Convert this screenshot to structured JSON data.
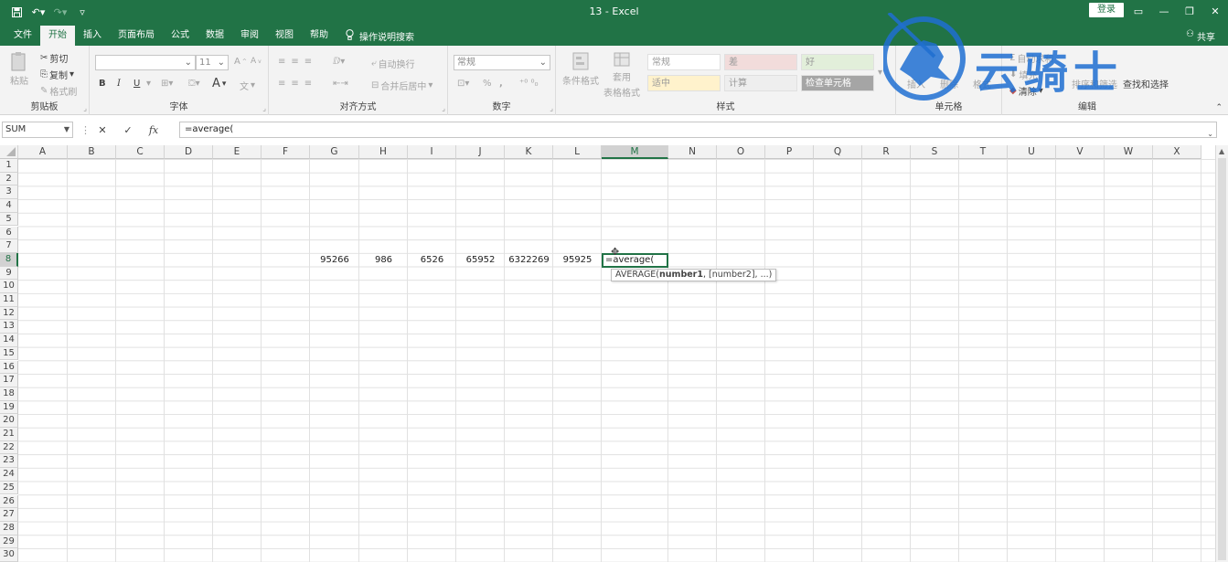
{
  "titlebar": {
    "title": "13  -  Excel",
    "login": "登录",
    "qat_icons": [
      "save-icon",
      "undo-icon",
      "redo-icon",
      "customize-icon"
    ]
  },
  "menu": {
    "tabs": [
      "文件",
      "开始",
      "插入",
      "页面布局",
      "公式",
      "数据",
      "审阅",
      "视图",
      "帮助"
    ],
    "active_tab": "开始",
    "tell_me": "操作说明搜索",
    "share": "共享"
  },
  "ribbon": {
    "clipboard": {
      "label": "剪贴板",
      "paste": "粘贴",
      "cut": "剪切",
      "copy": "复制",
      "format_painter": "格式刷"
    },
    "font": {
      "label": "字体",
      "font_name": "",
      "font_size": "11",
      "bold": "B",
      "italic": "I",
      "underline": "U",
      "grow": "A",
      "color_a": "A",
      "phonetic": "文"
    },
    "alignment": {
      "label": "对齐方式",
      "wrap": "自动换行",
      "merge": "合并后居中"
    },
    "number": {
      "label": "数字",
      "format": "常规",
      "percent": "%",
      "comma": ","
    },
    "styles": {
      "label": "样式",
      "conditional": "条件格式",
      "table": "套用",
      "table2": "表格格式",
      "cells": [
        "常规",
        "差",
        "好",
        "适中",
        "计算",
        "检查单元格"
      ]
    },
    "cells": {
      "label": "单元格",
      "insert": "插入",
      "delete": "删除",
      "format": "格式"
    },
    "editing": {
      "label": "编辑",
      "autosum": "自动求和",
      "fill": "填充",
      "clear": "清除",
      "sort": "排序和筛选",
      "find": "查找和选择"
    }
  },
  "watermark": {
    "text": "云骑士"
  },
  "formula_bar": {
    "name_box": "SUM",
    "cancel": "✕",
    "enter": "✓",
    "fx": "fx",
    "formula": "=average("
  },
  "grid": {
    "columns": [
      "A",
      "B",
      "C",
      "D",
      "E",
      "F",
      "G",
      "H",
      "I",
      "J",
      "K",
      "L",
      "M",
      "N",
      "O",
      "P",
      "Q",
      "R",
      "S",
      "T",
      "U",
      "V",
      "W",
      "X"
    ],
    "selected_column": "M",
    "rows": [
      "1",
      "2",
      "3",
      "4",
      "5",
      "6",
      "7",
      "8",
      "9",
      "10",
      "11",
      "12",
      "13",
      "14",
      "15",
      "16",
      "17",
      "18",
      "19",
      "20",
      "21",
      "22",
      "23",
      "24",
      "25",
      "26",
      "27",
      "28",
      "29",
      "30"
    ],
    "selected_row": "8",
    "row8_values": [
      {
        "col": "G",
        "value": "95266"
      },
      {
        "col": "H",
        "value": "986"
      },
      {
        "col": "I",
        "value": "6526"
      },
      {
        "col": "J",
        "value": "65952"
      },
      {
        "col": "K",
        "value": "6322269"
      },
      {
        "col": "L",
        "value": "95925"
      }
    ],
    "active_cell": {
      "ref": "M8",
      "value": "=average("
    },
    "tooltip": {
      "fn": "AVERAGE(",
      "arg1": "number1",
      ", ": "",
      "rest": ", [number2], ...)"
    }
  },
  "colors": {
    "excel_green": "#217346",
    "ribbon_bg": "#f3f3f3",
    "watermark_blue": "#1f6fd1"
  }
}
